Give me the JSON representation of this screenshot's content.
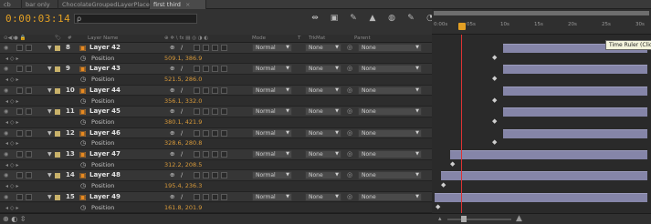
{
  "tabs": [
    {
      "label": "cb"
    },
    {
      "label": "bar only"
    },
    {
      "label": "ChocolateGroupedLayerPlace"
    },
    {
      "label": "first third",
      "close": "×"
    }
  ],
  "timecode": "0:00:03:14",
  "search": {
    "icon": "search-icon",
    "glyph": "ρ"
  },
  "header_icons": [
    {
      "name": "comp-flowchart-icon",
      "glyph": "⇹"
    },
    {
      "name": "draft-3d-icon",
      "glyph": "▣"
    },
    {
      "name": "hide-shy-icon",
      "glyph": "✎"
    },
    {
      "name": "frame-blending-icon",
      "glyph": "▲"
    },
    {
      "name": "motion-blur-icon",
      "glyph": "◍"
    },
    {
      "name": "brainstorm-icon",
      "glyph": "✎"
    },
    {
      "name": "auto-keyframe-icon",
      "glyph": "◔"
    },
    {
      "name": "graph-editor-icon",
      "glyph": "▤"
    }
  ],
  "columns": {
    "av": "⊙◀)● 🔒",
    "label": "🏷",
    "num": "#",
    "layer_name": "Layer Name",
    "switches": "⊕ ✲ \\ fx ▤ ◎ ◑ ◐",
    "mode": "Mode",
    "t": "T",
    "trkmat": "TrkMat",
    "parent": "Parent"
  },
  "layers": [
    {
      "num": "8",
      "name": "Layer 42",
      "prop": "Position",
      "value": "509.1, 386.9",
      "mode": "Normal",
      "trkmat": "None",
      "parent": "None"
    },
    {
      "num": "9",
      "name": "Layer 43",
      "prop": "Position",
      "value": "521.5, 286.0",
      "mode": "Normal",
      "trkmat": "None",
      "parent": "None"
    },
    {
      "num": "10",
      "name": "Layer 44",
      "prop": "Position",
      "value": "356.1, 332.0",
      "mode": "Normal",
      "trkmat": "None",
      "parent": "None"
    },
    {
      "num": "11",
      "name": "Layer 45",
      "prop": "Position",
      "value": "380.1, 421.9",
      "mode": "Normal",
      "trkmat": "None",
      "parent": "None"
    },
    {
      "num": "12",
      "name": "Layer 46",
      "prop": "Position",
      "value": "328.6, 280.8",
      "mode": "Normal",
      "trkmat": "None",
      "parent": "None"
    },
    {
      "num": "13",
      "name": "Layer 47",
      "prop": "Position",
      "value": "312.2, 208.5",
      "mode": "Normal",
      "trkmat": "None",
      "parent": "None"
    },
    {
      "num": "14",
      "name": "Layer 48",
      "prop": "Position",
      "value": "195.4, 236.3",
      "mode": "Normal",
      "trkmat": "None",
      "parent": "None"
    },
    {
      "num": "15",
      "name": "Layer 49",
      "prop": "Position",
      "value": "161.8, 201.9",
      "mode": "Normal",
      "trkmat": "None",
      "parent": "None"
    }
  ],
  "ruler": {
    "ticks": [
      "0:00s",
      "05s",
      "10s",
      "15s",
      "20s",
      "25s",
      "30s"
    ],
    "tooltip": "Time Ruler (Click"
  },
  "colors": {
    "timecode": "#e3a024",
    "layer_bar": "#8585a8",
    "playhead": "#dd3333",
    "value": "#d89a3a"
  },
  "footer": {
    "icons": "⊕ ◐ ⇳"
  }
}
